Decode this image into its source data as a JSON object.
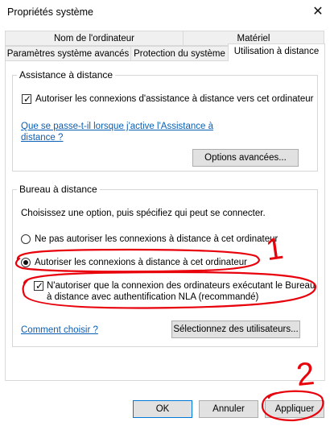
{
  "window": {
    "title": "Propriétés système"
  },
  "tabs": {
    "row1": [
      "Nom de l'ordinateur",
      "Matériel"
    ],
    "row2": [
      "Paramètres système avancés",
      "Protection du système",
      "Utilisation à distance"
    ],
    "active": "Utilisation à distance"
  },
  "remote_assistance": {
    "legend": "Assistance à distance",
    "allow_checkbox_label": "Autoriser les connexions d'assistance à distance vers cet ordinateur",
    "allow_checked": true,
    "help_link_line1": "Que se passe-t-il lorsque j'active l'Assistance à",
    "help_link_line2": "distance ?",
    "advanced_button": "Options avancées..."
  },
  "remote_desktop": {
    "legend": "Bureau à distance",
    "instruction": "Choisissez une option, puis spécifiez qui peut se connecter.",
    "option_deny": "Ne pas autoriser les connexions à distance à cet ordinateur",
    "option_allow": "Autoriser les connexions à distance à cet ordinateur",
    "selected": "option_allow",
    "nla_label_line1": "N'autoriser que la connexion des ordinateurs exécutant le Bureau",
    "nla_label_line2": "à distance avec authentification NLA (recommandé)",
    "nla_checked": true,
    "help_link": "Comment choisir ?",
    "select_users_button": "Sélectionnez des utilisateurs..."
  },
  "footer": {
    "ok": "OK",
    "cancel": "Annuler",
    "apply": "Appliquer"
  },
  "annotations": {
    "marker_1": "1",
    "marker_2": "2",
    "color": "#e8000b"
  },
  "icons": {
    "close": "close-icon",
    "checkbox_mark": "checkmark-icon"
  }
}
